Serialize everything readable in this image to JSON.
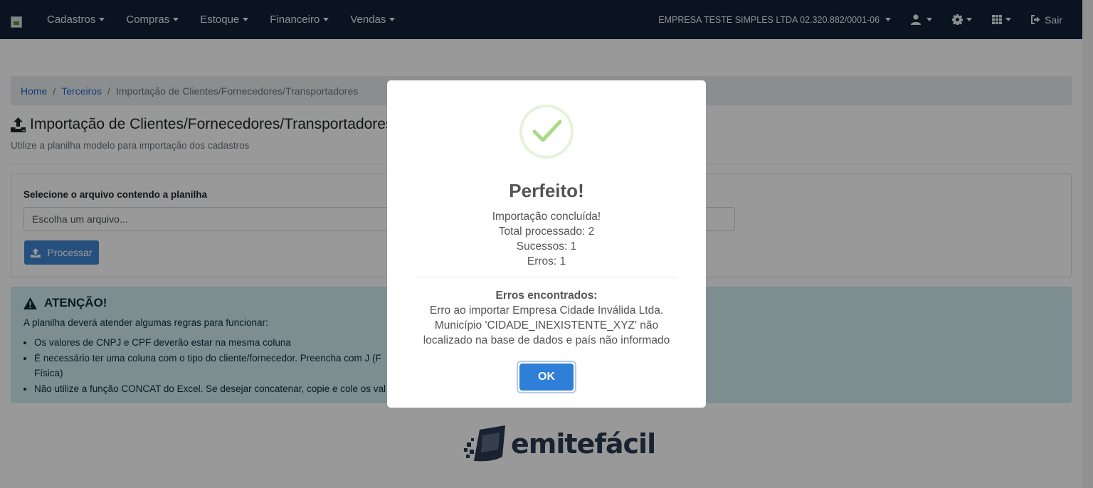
{
  "navbar": {
    "menu": [
      {
        "label": "Cadastros"
      },
      {
        "label": "Compras"
      },
      {
        "label": "Estoque"
      },
      {
        "label": "Financeiro"
      },
      {
        "label": "Vendas"
      }
    ],
    "company": "EMPRESA TESTE SIMPLES LTDA 02.320.882/0001-06",
    "icons": [
      "user-icon",
      "gear-icon",
      "grid-icon",
      "sign-out-icon"
    ],
    "logout_label": "Sair"
  },
  "breadcrumb": {
    "home": "Home",
    "sep1": "/",
    "terceiros": "Terceiros",
    "sep2": "/",
    "current": "Importação de Clientes/Fornecedores/Transportadores"
  },
  "page": {
    "title": "Importação de Clientes/Fornecedores/Transportadores",
    "subtitle": "Utilize a planilha modelo para importação dos cadastros"
  },
  "upload": {
    "label": "Selecione o arquivo contendo a planilha",
    "placeholder": "Escolha um arquivo...",
    "button": "Processar"
  },
  "alert": {
    "title": "ATENÇÃO!",
    "text": "A planilha deverá atender algumas regras para funcionar:",
    "items": [
      "Os valores de CNPJ e CPF deverão estar na mesma coluna",
      "É necessário ter uma coluna com o tipo do cliente/fornecedor. Preencha com J (F",
      "Física)",
      "Não utilize a função CONCAT do Excel. Se desejar concatenar, copie e cole os val"
    ]
  },
  "logo": {
    "text_emite": "emite",
    "text_facil": "fácil"
  },
  "modal": {
    "title": "Perfeito!",
    "lines": [
      "Importação concluída!",
      "Total processado: 2",
      "Sucessos: 1",
      "Erros: 1"
    ],
    "errors_title": "Erros encontrados:",
    "errors_text": "Erro ao importar Empresa Cidade Inválida Ltda. Município 'CIDADE_INEXISTENTE_XYZ' não localizado na base de dados e país não informado",
    "ok_label": "OK"
  },
  "colors": {
    "navbar": "#0f2236",
    "primary": "#3f86d3",
    "success": "#a5dc86",
    "alert_bg": "#d1ecf1"
  }
}
